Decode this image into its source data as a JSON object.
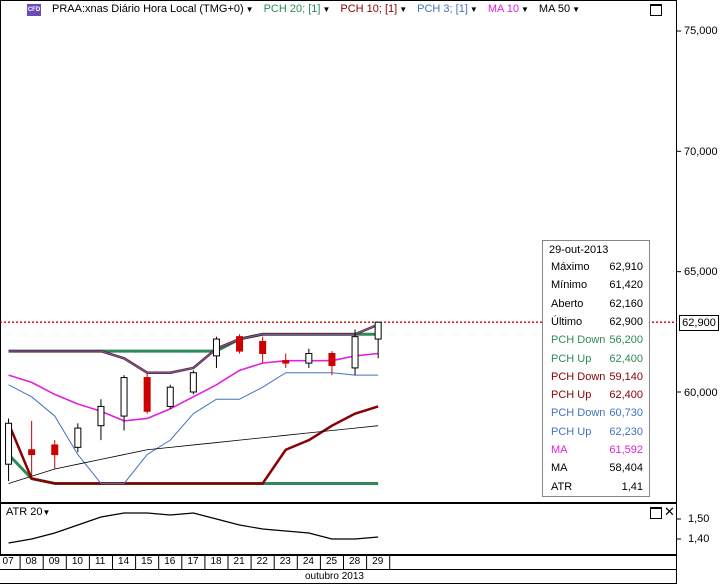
{
  "header": {
    "symbol_icon": "CFD",
    "symbol_label": "PRAA:xnas Diário Hora Local (TMG+0)",
    "indicators": [
      {
        "label": "PCH 20; [1]",
        "color": "#2e8b57"
      },
      {
        "label": "PCH 10; [1]",
        "color": "#8b0000"
      },
      {
        "label": "PCH 3; [1]",
        "color": "#4472c4"
      },
      {
        "label": "MA 10",
        "color": "#e020e0"
      },
      {
        "label": "MA 50",
        "color": "#000000"
      }
    ]
  },
  "price_axis": {
    "ticks": [
      "75,000",
      "70,000",
      "65,000",
      "60,000"
    ],
    "current_price_tag": "62,900"
  },
  "atr_panel": {
    "legend": "ATR 20",
    "ticks": [
      "1,50",
      "1,40"
    ]
  },
  "x_axis": {
    "day_labels": [
      "07",
      "08",
      "09",
      "10",
      "11",
      "14",
      "15",
      "16",
      "17",
      "18",
      "21",
      "22",
      "23",
      "24",
      "25",
      "28",
      "29"
    ],
    "month_label": "outubro 2013"
  },
  "info_box": {
    "date": "29-out-2013",
    "rows": [
      {
        "label": "Máximo",
        "value": "62,910",
        "color": "#000000"
      },
      {
        "label": "Mínimo",
        "value": "61,420",
        "color": "#000000"
      },
      {
        "label": "Aberto",
        "value": "62,160",
        "color": "#000000"
      },
      {
        "label": "Último",
        "value": "62,900",
        "color": "#000000"
      },
      {
        "label": "PCH Down",
        "value": "56,200",
        "color": "#2e8b57"
      },
      {
        "label": "PCH Up",
        "value": "62,400",
        "color": "#2e8b57"
      },
      {
        "label": "PCH Down",
        "value": "59,140",
        "color": "#8b0000"
      },
      {
        "label": "PCH Up",
        "value": "62,400",
        "color": "#8b0000"
      },
      {
        "label": "PCH Down",
        "value": "60,730",
        "color": "#4472c4"
      },
      {
        "label": "PCH Up",
        "value": "62,230",
        "color": "#4472c4"
      },
      {
        "label": "MA",
        "value": "61,592",
        "color": "#e020e0"
      },
      {
        "label": "MA",
        "value": "58,404",
        "color": "#000000"
      },
      {
        "label": "ATR",
        "value": "1,41",
        "color": "#000000"
      }
    ]
  },
  "chart_data": {
    "type": "candlestick",
    "x": [
      "07",
      "08",
      "09",
      "10",
      "11",
      "14",
      "15",
      "16",
      "17",
      "18",
      "21",
      "22",
      "23",
      "24",
      "25",
      "28",
      "29"
    ],
    "ylim": [
      55.5,
      76.5
    ],
    "last_price": 62.9,
    "candles": [
      {
        "o": 57.0,
        "h": 58.9,
        "l": 56.3,
        "c": 58.7
      },
      {
        "o": 57.6,
        "h": 58.8,
        "l": 56.5,
        "c": 57.4
      },
      {
        "o": 57.8,
        "h": 58.0,
        "l": 56.8,
        "c": 57.4
      },
      {
        "o": 57.7,
        "h": 58.7,
        "l": 57.5,
        "c": 58.5
      },
      {
        "o": 58.6,
        "h": 59.7,
        "l": 58.0,
        "c": 59.4
      },
      {
        "o": 59.0,
        "h": 60.7,
        "l": 58.4,
        "c": 60.6
      },
      {
        "o": 60.6,
        "h": 60.8,
        "l": 59.1,
        "c": 59.2
      },
      {
        "o": 59.4,
        "h": 60.3,
        "l": 59.3,
        "c": 60.2
      },
      {
        "o": 60.0,
        "h": 60.9,
        "l": 59.9,
        "c": 60.8
      },
      {
        "o": 61.5,
        "h": 62.3,
        "l": 61.0,
        "c": 62.2
      },
      {
        "o": 62.3,
        "h": 62.4,
        "l": 61.6,
        "c": 61.7
      },
      {
        "o": 62.1,
        "h": 62.3,
        "l": 61.2,
        "c": 61.6
      },
      {
        "o": 61.3,
        "h": 61.6,
        "l": 61.0,
        "c": 61.2
      },
      {
        "o": 61.2,
        "h": 61.8,
        "l": 61.0,
        "c": 61.6
      },
      {
        "o": 61.6,
        "h": 61.7,
        "l": 60.7,
        "c": 61.1
      },
      {
        "o": 61.0,
        "h": 62.6,
        "l": 60.7,
        "c": 62.3
      },
      {
        "o": 62.2,
        "h": 62.9,
        "l": 61.4,
        "c": 62.9
      }
    ],
    "series": [
      {
        "name": "PCH 20 Up",
        "color": "#2e8b57",
        "values": [
          61.7,
          61.7,
          61.7,
          61.7,
          61.7,
          61.7,
          61.7,
          61.7,
          61.7,
          61.7,
          62.2,
          62.4,
          62.4,
          62.4,
          62.4,
          62.4,
          62.4
        ]
      },
      {
        "name": "PCH 20 Down",
        "color": "#2e8b57",
        "values": [
          57.4,
          56.4,
          56.2,
          56.2,
          56.2,
          56.2,
          56.2,
          56.2,
          56.2,
          56.2,
          56.2,
          56.2,
          56.2,
          56.2,
          56.2,
          56.2,
          56.2
        ]
      },
      {
        "name": "PCH 10 Up",
        "color": "#8b0000",
        "values": [
          61.7,
          61.7,
          61.7,
          61.7,
          61.7,
          61.4,
          60.8,
          60.8,
          61.0,
          61.8,
          62.2,
          62.4,
          62.4,
          62.4,
          62.4,
          62.4,
          62.8
        ]
      },
      {
        "name": "PCH 10 Down",
        "color": "#8b0000",
        "values": [
          58.7,
          56.4,
          56.2,
          56.2,
          56.2,
          56.2,
          56.2,
          56.2,
          56.2,
          56.2,
          56.2,
          56.2,
          57.6,
          58.0,
          58.6,
          59.1,
          59.4
        ]
      },
      {
        "name": "PCH 3 Up",
        "color": "#4472c4",
        "values": [
          61.7,
          61.7,
          61.7,
          61.7,
          61.7,
          61.4,
          60.8,
          60.8,
          61.0,
          61.8,
          62.2,
          62.4,
          62.4,
          62.4,
          62.4,
          62.4,
          62.8
        ]
      },
      {
        "name": "PCH 3 Down",
        "color": "#4472c4",
        "values": [
          60.3,
          59.8,
          59.0,
          57.4,
          56.2,
          56.2,
          57.4,
          58.0,
          59.1,
          59.7,
          59.7,
          60.2,
          60.8,
          60.8,
          60.8,
          60.7,
          60.7
        ]
      },
      {
        "name": "MA 10",
        "color": "#e020e0",
        "values": [
          60.7,
          60.4,
          59.9,
          59.5,
          59.2,
          58.8,
          58.9,
          59.3,
          59.8,
          60.3,
          60.9,
          61.2,
          61.3,
          61.3,
          61.3,
          61.5,
          61.6
        ]
      },
      {
        "name": "MA 50",
        "color": "#000000",
        "values": [
          56.2,
          56.5,
          56.8,
          57.0,
          57.2,
          57.4,
          57.6,
          57.7,
          57.8,
          57.9,
          58.0,
          58.1,
          58.2,
          58.3,
          58.4,
          58.5,
          58.6
        ]
      }
    ],
    "atr": {
      "ylim": [
        1.35,
        1.55
      ],
      "ticks": [
        1.5,
        1.4
      ],
      "values": [
        1.38,
        1.4,
        1.43,
        1.47,
        1.51,
        1.53,
        1.53,
        1.52,
        1.53,
        1.5,
        1.47,
        1.45,
        1.44,
        1.43,
        1.4,
        1.4,
        1.41
      ]
    }
  }
}
